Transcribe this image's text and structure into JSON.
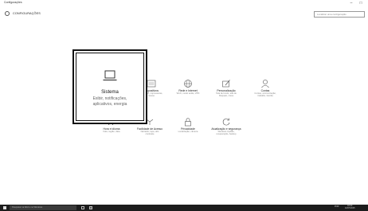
{
  "window": {
    "title": "Configurações",
    "minimize": "–",
    "maximize": "□"
  },
  "header": {
    "title": "CONFIGURAÇÕES",
    "search_placeholder": "Localizar uma configuração"
  },
  "focused_tile": {
    "title": "Sistema",
    "desc_line1": "Exibir, notificações,",
    "desc_line2": "aplicativos, energia"
  },
  "tiles": [
    {
      "title": "Dispositivos",
      "desc1": "Bluetooth, impressoras,",
      "desc2": "mouse"
    },
    {
      "title": "Rede e Internet",
      "desc1": "Wi-Fi, modo avião, VPN",
      "desc2": ""
    },
    {
      "title": "Personalização",
      "desc1": "Tela de fundo, tela de",
      "desc2": "bloqueio, cores"
    },
    {
      "title": "Contas",
      "desc1": "Contas, sincronização,",
      "desc2": "trabalho, família"
    },
    {
      "title": "Hora e idioma",
      "desc1": "Fala, região, data",
      "desc2": ""
    },
    {
      "title": "Facilidade de Acesso",
      "desc1": "Narrador, lupa, alto",
      "desc2": "contraste"
    },
    {
      "title": "Privacidade",
      "desc1": "Localização, câmera",
      "desc2": ""
    },
    {
      "title": "Atualização e segurança",
      "desc1": "Windows Update,",
      "desc2": "recuperação, backup"
    }
  ],
  "taskbar": {
    "search_text": "Pesquisar na Web e no Windows",
    "tray_time": "18:00",
    "tray_date": "10/07/2015",
    "tray_lang": "POR"
  }
}
